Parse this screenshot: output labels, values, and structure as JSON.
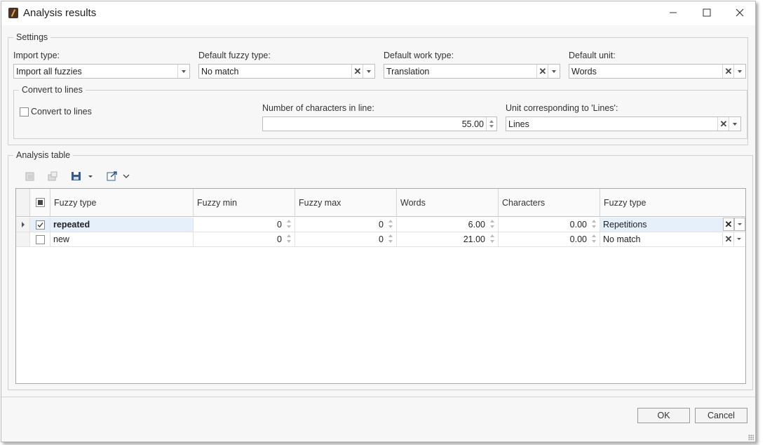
{
  "window": {
    "title": "Analysis results"
  },
  "settings": {
    "legend": "Settings",
    "import_type": {
      "label": "Import type:",
      "value": "Import all fuzzies"
    },
    "default_fuzzy_type": {
      "label": "Default fuzzy type:",
      "value": "No match"
    },
    "default_work_type": {
      "label": "Default work type:",
      "value": "Translation"
    },
    "default_unit": {
      "label": "Default unit:",
      "value": "Words"
    },
    "convert": {
      "legend": "Convert to lines",
      "checkbox_label": "Convert to lines",
      "checked": false,
      "chars_label": "Number of characters in line:",
      "chars_value": "55.00",
      "unit_label": "Unit corresponding to 'Lines':",
      "unit_value": "Lines"
    }
  },
  "analysis": {
    "legend": "Analysis table",
    "toolbar": [
      "delete-rows-icon",
      "copy-rows-icon",
      "save-icon",
      "dropdown-arrow-icon",
      "export-icon",
      "chevron-down-icon"
    ],
    "columns": [
      "Fuzzy type",
      "Fuzzy min",
      "Fuzzy max",
      "Words",
      "Characters",
      "Fuzzy type"
    ],
    "rows": [
      {
        "checked": true,
        "fuzzy_type": "repeated",
        "fuzzy_min": "0",
        "fuzzy_max": "0",
        "words": "6.00",
        "characters": "0.00",
        "mapped_type": "Repetitions"
      },
      {
        "checked": false,
        "fuzzy_type": "new",
        "fuzzy_min": "0",
        "fuzzy_max": "0",
        "words": "21.00",
        "characters": "0.00",
        "mapped_type": "No match"
      }
    ]
  },
  "footer": {
    "ok": "OK",
    "cancel": "Cancel"
  },
  "colors": {
    "selected_row": "#e5f0fb",
    "window_bg": "#f7f7f7",
    "border": "#bdbdbd"
  }
}
